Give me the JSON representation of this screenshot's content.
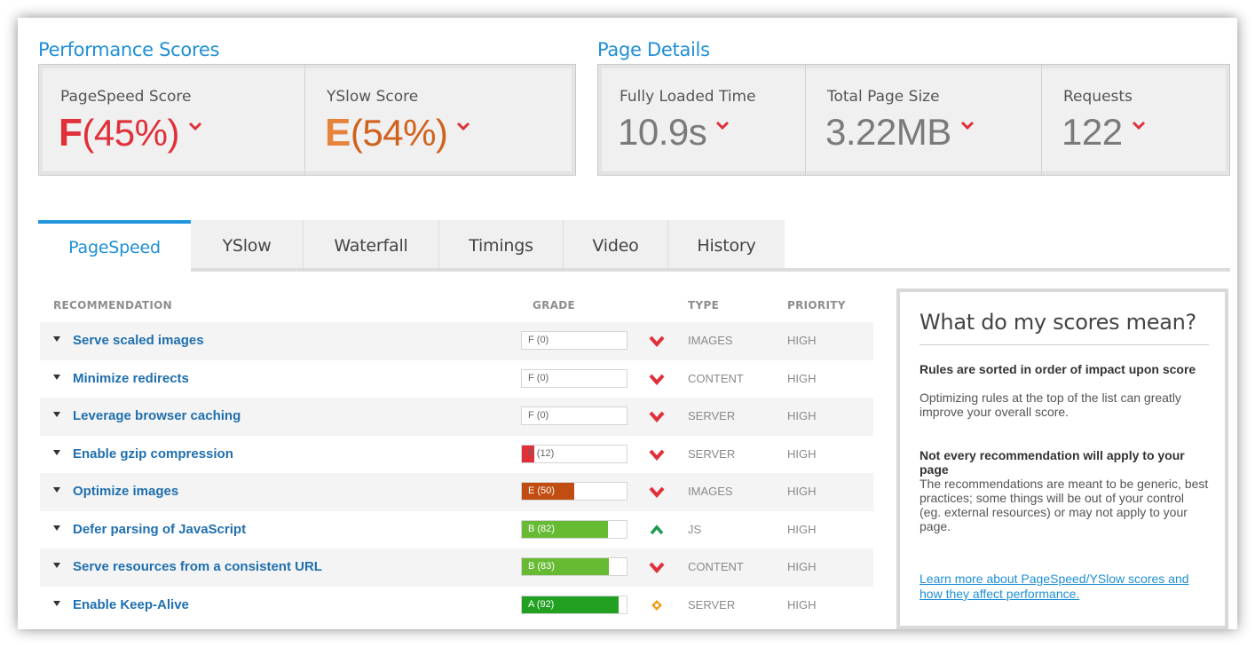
{
  "performance_scores": {
    "title": "Performance Scores",
    "pagespeed": {
      "label": "PageSpeed Score",
      "grade": "F",
      "percent": "(45%)"
    },
    "yslow": {
      "label": "YSlow Score",
      "grade": "E",
      "percent": "(54%)"
    }
  },
  "page_details": {
    "title": "Page Details",
    "fully_loaded": {
      "label": "Fully Loaded Time",
      "value": "10.9s"
    },
    "total_size": {
      "label": "Total Page Size",
      "value": "3.22MB"
    },
    "requests": {
      "label": "Requests",
      "value": "122"
    }
  },
  "tabs": [
    "PageSpeed",
    "YSlow",
    "Waterfall",
    "Timings",
    "Video",
    "History"
  ],
  "active_tab": "PageSpeed",
  "table": {
    "headers": {
      "recommendation": "RECOMMENDATION",
      "grade": "GRADE",
      "type": "TYPE",
      "priority": "PRIORITY"
    },
    "rows": [
      {
        "name": "Serve scaled images",
        "grade": "F (0)",
        "score": 0,
        "color": "#e0303a",
        "trend": "down",
        "type": "IMAGES",
        "priority": "HIGH"
      },
      {
        "name": "Minimize redirects",
        "grade": "F (0)",
        "score": 0,
        "color": "#e0303a",
        "trend": "down",
        "type": "CONTENT",
        "priority": "HIGH"
      },
      {
        "name": "Leverage browser caching",
        "grade": "F (0)",
        "score": 0,
        "color": "#e0303a",
        "trend": "down",
        "type": "SERVER",
        "priority": "HIGH"
      },
      {
        "name": "Enable gzip compression",
        "grade": "F (12)",
        "score": 12,
        "color": "#e0303a",
        "trend": "down",
        "type": "SERVER",
        "priority": "HIGH"
      },
      {
        "name": "Optimize images",
        "grade": "E (50)",
        "score": 50,
        "color": "#c24d12",
        "trend": "down",
        "type": "IMAGES",
        "priority": "HIGH"
      },
      {
        "name": "Defer parsing of JavaScript",
        "grade": "B (82)",
        "score": 82,
        "color": "#66bb33",
        "trend": "up",
        "type": "JS",
        "priority": "HIGH"
      },
      {
        "name": "Serve resources from a consistent URL",
        "grade": "B (83)",
        "score": 83,
        "color": "#66bb33",
        "trend": "down",
        "type": "CONTENT",
        "priority": "HIGH"
      },
      {
        "name": "Enable Keep-Alive",
        "grade": "A (92)",
        "score": 92,
        "color": "#22a022",
        "trend": "neutral",
        "type": "SERVER",
        "priority": "HIGH"
      }
    ]
  },
  "info_box": {
    "title": "What do my scores mean?",
    "sections": [
      {
        "heading": "Rules are sorted in order of impact upon score",
        "body": "Optimizing rules at the top of the list can greatly improve your overall score."
      },
      {
        "heading": "Not every recommendation will apply to your page",
        "body": "The recommendations are meant to be generic, best practices; some things will be out of your control (eg. external resources) or may not apply to your page."
      }
    ],
    "link": "Learn more about PageSpeed/YSlow scores and how they affect performance."
  },
  "colors": {
    "accent": "#1f8fd6",
    "bad": "#e0303a",
    "warn": "#e6823a",
    "good": "#22a022",
    "neutral": "#f0a020"
  }
}
